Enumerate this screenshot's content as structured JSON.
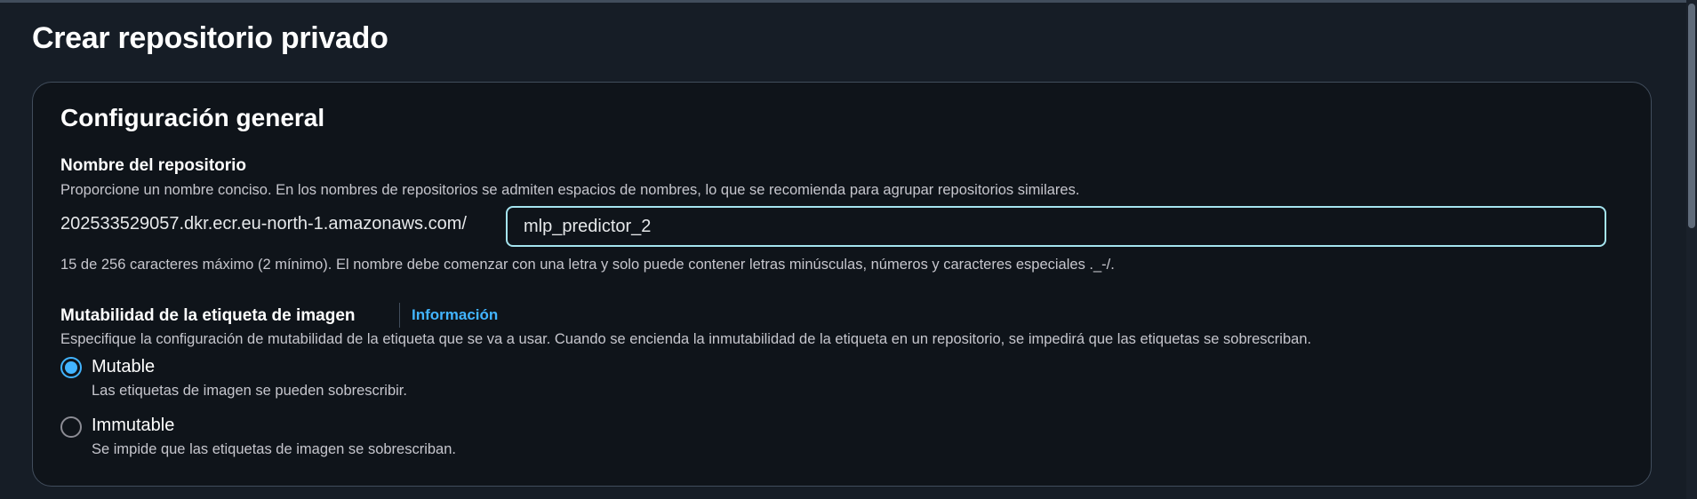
{
  "page": {
    "title": "Crear repositorio privado"
  },
  "general": {
    "title": "Configuración general",
    "repo_name": {
      "label": "Nombre del repositorio",
      "description": "Proporcione un nombre conciso. En los nombres de repositorios se admiten espacios de nombres, lo que se recomienda para agrupar repositorios similares.",
      "uri_prefix": "202533529057.dkr.ecr.eu-north-1.amazonaws.com/",
      "value": "mlp_predictor_2",
      "constraint": "15 de 256 caracteres máximo (2 mínimo). El nombre debe comenzar con una letra y solo puede contener letras minúsculas, números y caracteres especiales ._-/."
    },
    "mutability": {
      "label": "Mutabilidad de la etiqueta de imagen",
      "info_link": "Información",
      "description": "Especifique la configuración de mutabilidad de la etiqueta que se va a usar. Cuando se encienda la inmutabilidad de la etiqueta en un repositorio, se impedirá que las etiquetas se sobrescriban.",
      "options": [
        {
          "label": "Mutable",
          "description": "Las etiquetas de imagen se pueden sobrescribir.",
          "selected": true
        },
        {
          "label": "Immutable",
          "description": "Se impide que las etiquetas de imagen se sobrescriban.",
          "selected": false
        }
      ]
    }
  },
  "colors": {
    "background": "#161d26",
    "panel": "#0f141a",
    "accent": "#42b4ff",
    "focus_ring": "#a5e4ef"
  }
}
